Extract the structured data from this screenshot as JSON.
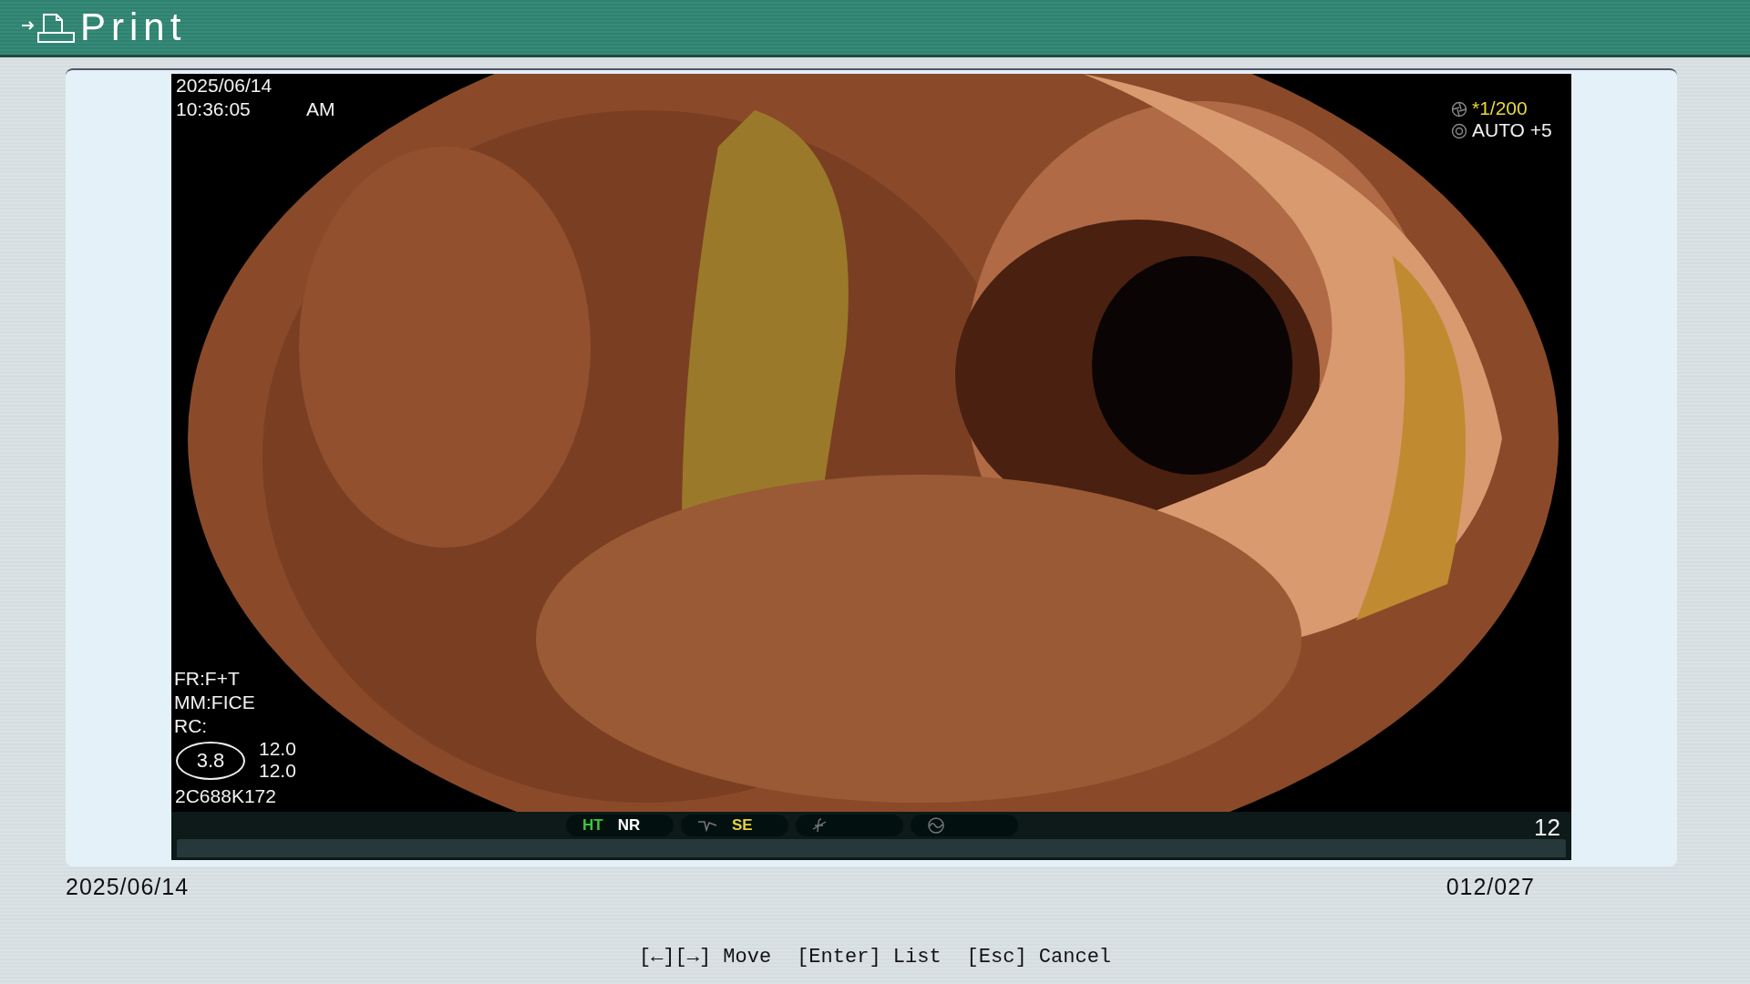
{
  "header": {
    "title": "Print"
  },
  "image": {
    "date": "2025/06/14",
    "time": "10:36:05",
    "meridiem": "AM",
    "shutter": "*1/200",
    "exposure": "AUTO +5",
    "info_lines": [
      "FR:F+T",
      "MM:FICE",
      "RC:"
    ],
    "zoom": "3.8",
    "zoom_values": [
      "12.0",
      "12.0"
    ],
    "serial": "2C688K172"
  },
  "status_bar": {
    "groups": [
      {
        "kind": "enhance",
        "items": [
          {
            "label": "HT",
            "color": "#3cc83c"
          },
          {
            "label": "NR",
            "color": "#ffffff"
          }
        ]
      },
      {
        "kind": "structure",
        "items": [
          {
            "label": "SE",
            "color": "#e6d23c"
          }
        ]
      },
      {
        "kind": "color"
      },
      {
        "kind": "contrast"
      }
    ],
    "frame_count": "12"
  },
  "footer": {
    "date": "2025/06/14",
    "counter": "012/027",
    "hints": [
      "[←][→] Move",
      "[Enter] List",
      "[Esc] Cancel"
    ]
  }
}
